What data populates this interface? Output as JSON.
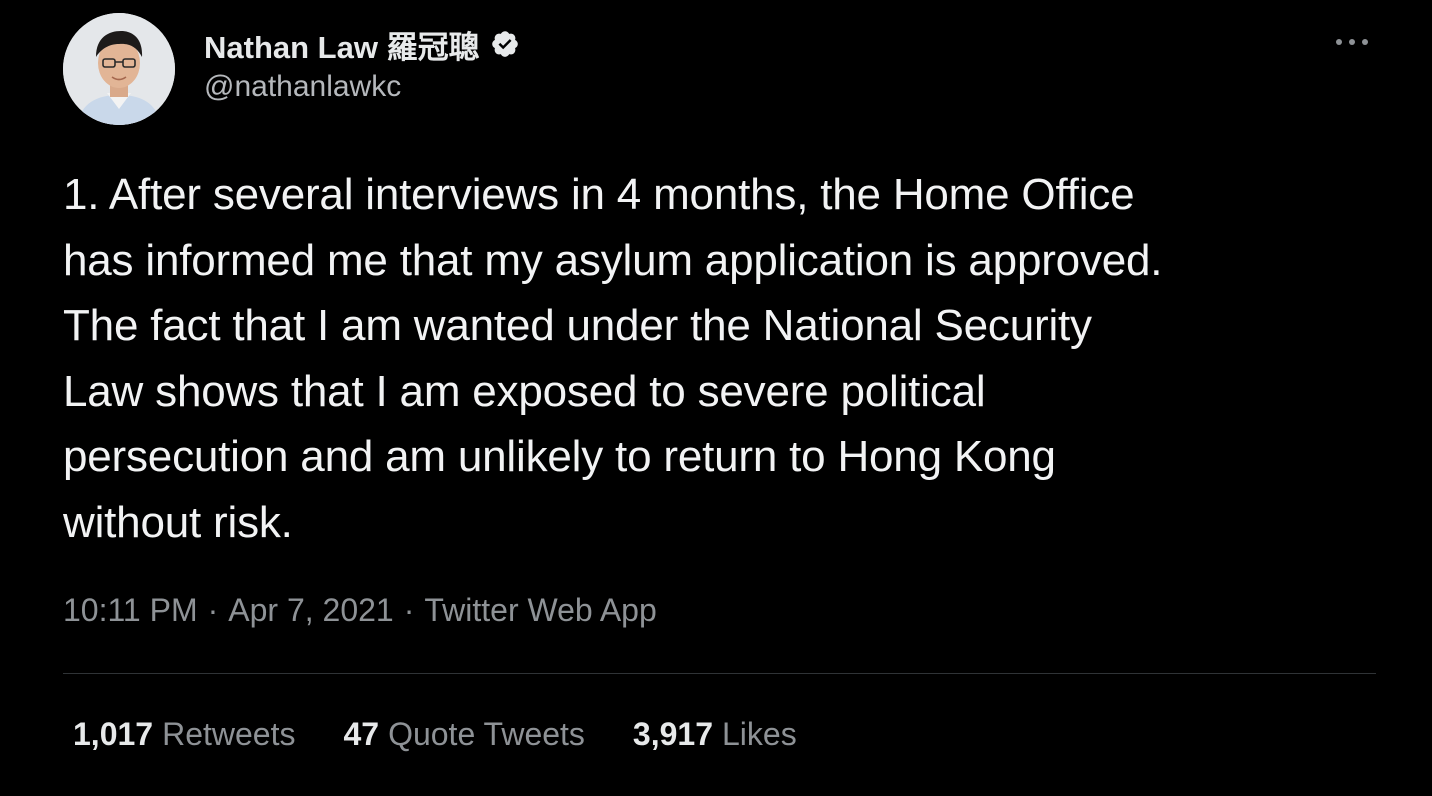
{
  "author": {
    "display_name": "Nathan Law 羅冠聰",
    "handle": "@nathanlawkc",
    "verified_icon": "verified-badge-icon"
  },
  "tweet": {
    "lines": [
      "1. After several interviews in 4 months, the Home Office",
      "has informed me that my asylum application is approved.",
      "The fact that I am wanted under the National Security",
      "Law shows that I am exposed to severe political",
      "persecution and am unlikely to return to Hong Kong",
      "without risk."
    ]
  },
  "meta": {
    "time": "10:11 PM",
    "separator": "·",
    "date": "Apr 7, 2021",
    "source": "Twitter Web App"
  },
  "stats": {
    "retweets_count": "1,017",
    "retweets_label": "Retweets",
    "quotes_count": "47",
    "quotes_label": "Quote Tweets",
    "likes_count": "3,917",
    "likes_label": "Likes"
  },
  "colors": {
    "background": "#000000",
    "primary_text": "#e7e9ea",
    "secondary_text": "#8e9296",
    "divider": "#2f3336"
  }
}
